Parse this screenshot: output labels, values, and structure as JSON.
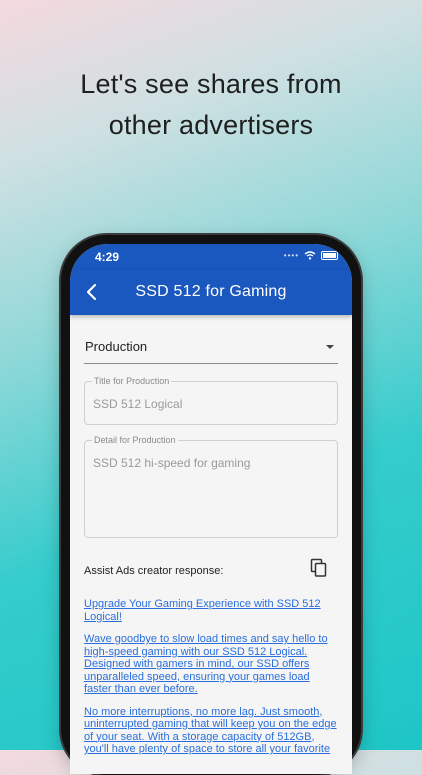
{
  "headline": {
    "line1": "Let's see shares from",
    "line2": "other advertisers"
  },
  "status": {
    "time": "4:29"
  },
  "appbar": {
    "title": "SSD 512 for Gaming"
  },
  "dropdown": {
    "value": "Production"
  },
  "title_field": {
    "label": "Title for Production",
    "value": "SSD 512 Logical"
  },
  "detail_field": {
    "label": "Detail for Production",
    "value": "SSD 512 hi-speed for gaming"
  },
  "assist": {
    "label": "Assist Ads creator response:"
  },
  "response": {
    "p1": "Upgrade Your Gaming Experience with SSD 512 Logical!",
    "p2": "Wave goodbye to slow load times and say hello to high-speed gaming with our SSD 512 Logical. Designed with gamers in mind, our SSD offers unparalleled speed, ensuring your games load faster than ever before.",
    "p3": "No more interruptions, no more lag. Just smooth, uninterrupted gaming that will keep you on the edge of your seat. With a storage capacity of 512GB, you'll have plenty of space to store all your favorite"
  },
  "colors": {
    "appbar": "#1a57bf",
    "link": "#2a6fdc"
  }
}
